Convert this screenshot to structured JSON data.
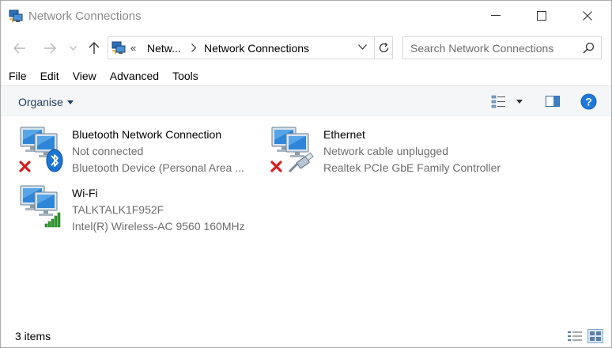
{
  "window": {
    "title": "Network Connections"
  },
  "address": {
    "overflow_chevron": "«",
    "crumbs": [
      "Netw...",
      "Network Connections"
    ]
  },
  "search": {
    "placeholder": "Search Network Connections"
  },
  "menu": {
    "items": [
      "File",
      "Edit",
      "View",
      "Advanced",
      "Tools"
    ]
  },
  "toolbar": {
    "organise_label": "Organise"
  },
  "connections": [
    {
      "name": "Bluetooth Network Connection",
      "status": "Not connected",
      "device": "Bluetooth Device (Personal Area ...",
      "badge_icon": "bluetooth-icon",
      "error": true
    },
    {
      "name": "Ethernet",
      "status": "Network cable unplugged",
      "device": "Realtek PCIe GbE Family Controller",
      "badge_icon": "ethernet-cable-icon",
      "error": true
    },
    {
      "name": "Wi-Fi",
      "status": "TALKTALK1F952F",
      "device": "Intel(R) Wireless-AC 9560 160MHz",
      "badge_icon": "wifi-signal-icon",
      "error": false
    }
  ],
  "statusbar": {
    "count": "3 items"
  },
  "colors": {
    "accent": "#0063b1",
    "error_red": "#d61f1f",
    "signal_green": "#2e9c2e",
    "command_bar": "#f5f6f7"
  }
}
